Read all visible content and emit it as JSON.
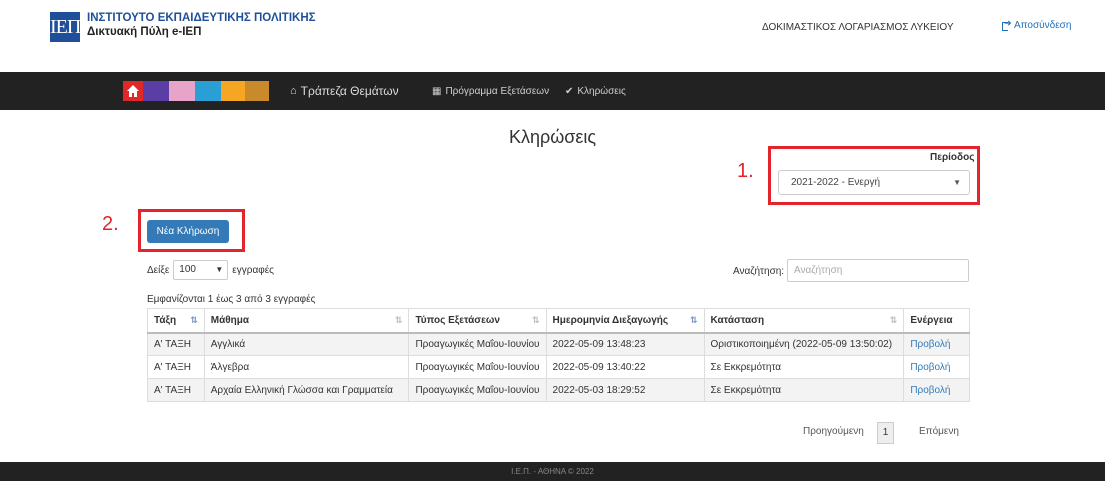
{
  "header": {
    "logo_text": "ΙΕΠ",
    "title": "ΙΝΣΤΙΤΟΥΤΟ ΕΚΠΑΙΔΕΥΤΙΚΗΣ ΠΟΛΙΤΙΚΗΣ",
    "subtitle": "Δικτυακή Πύλη e-ΙΕΠ",
    "account": "ΔΟΚΙΜΑΣΤΙΚΟΣ ΛΟΓΑΡΙΑΣΜΟΣ ΛΥΚΕΙΟΥ",
    "logout": "Αποσύνδεση"
  },
  "nav": {
    "home_icon": "home-icon",
    "swatch_colors": [
      "#5b3ea5",
      "#e8a3c8",
      "#2a9fd6",
      "#f5a623",
      "#c98a2b"
    ],
    "items": [
      {
        "label": "Τράπεζα Θεμάτων",
        "icon": "home-icon"
      },
      {
        "label": "Πρόγραμμα Εξετάσεων",
        "icon": "calendar-icon"
      },
      {
        "label": "Κληρώσεις",
        "icon": "check-icon"
      }
    ]
  },
  "page": {
    "title": "Κληρώσεις",
    "period_label": "Περίοδος",
    "period_value": "2021-2022 - Ενεργή",
    "new_button": "Νέα Κλήρωση",
    "annotations": [
      "1.",
      "2."
    ],
    "annotation_color": "#e3242b"
  },
  "table_controls": {
    "show": "Δείξε",
    "length": "100",
    "records": "εγγραφές",
    "search_label": "Αναζήτηση:",
    "search_placeholder": "Αναζήτηση",
    "info": "Εμφανίζονται 1 έως 3 από 3 εγγραφές"
  },
  "table": {
    "columns": [
      "Τάξη",
      "Μάθημα",
      "Τύπος Εξετάσεων",
      "Ημερομηνία Διεξαγωγής",
      "Κατάσταση",
      "Ενέργεια"
    ],
    "rows": [
      [
        "Α' ΤΑΞΗ",
        "Αγγλικά",
        "Προαγωγικές Μαΐου-Ιουνίου",
        "2022-05-09 13:48:23",
        "Οριστικοποιημένη (2022-05-09 13:50:02)",
        "Προβολή"
      ],
      [
        "Α' ΤΑΞΗ",
        "Άλγεβρα",
        "Προαγωγικές Μαΐου-Ιουνίου",
        "2022-05-09 13:40:22",
        "Σε Εκκρεμότητα",
        "Προβολή"
      ],
      [
        "Α' ΤΑΞΗ",
        "Αρχαία Ελληνική Γλώσσα και Γραμματεία",
        "Προαγωγικές Μαΐου-Ιουνίου",
        "2022-05-03 18:29:52",
        "Σε Εκκρεμότητα",
        "Προβολή"
      ]
    ]
  },
  "pagination": {
    "prev": "Προηγούμενη",
    "current": "1",
    "next": "Επόμενη"
  },
  "footer": {
    "text": "Ι.Ε.Π. - ΑΘΗΝΑ © 2022"
  }
}
